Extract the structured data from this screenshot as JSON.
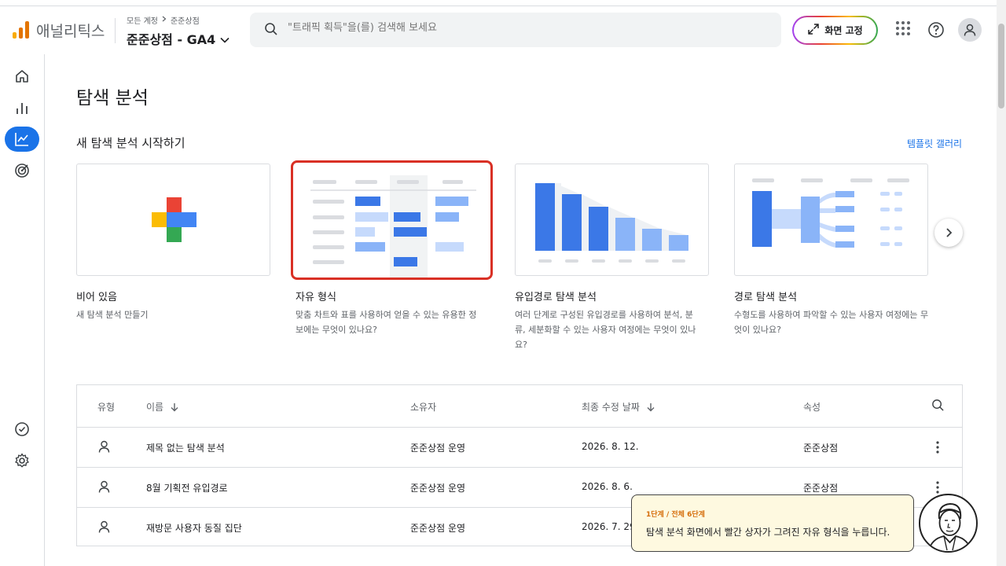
{
  "header": {
    "logo_text": "애널리틱스",
    "breadcrumb": [
      "모든 계정",
      "준준상점"
    ],
    "account_title": "준준상점 - GA4",
    "search_placeholder": "\"트래픽 획득\"을(를) 검색해 보세요",
    "pin_label": "화면 고정",
    "logo_colors": [
      "#f9ab00",
      "#e37400",
      "#e37400"
    ]
  },
  "sidebar": {
    "items": [
      {
        "icon": "home-icon"
      },
      {
        "icon": "bar-chart-icon"
      },
      {
        "icon": "explore-icon",
        "active": true
      },
      {
        "icon": "advertising-icon"
      },
      {
        "icon": "check-circle-icon"
      },
      {
        "icon": "gear-icon"
      }
    ],
    "active_color": "#1a73e8"
  },
  "main": {
    "page_title": "탐색 분석",
    "section_title": "새 탐색 분석 시작하기",
    "template_link": "템플릿 갤러리",
    "cards": [
      {
        "title": "비어 있음",
        "desc": "새 탐색 분석 만들기"
      },
      {
        "title": "자유 형식",
        "desc": "맞춤 차트와 표를 사용하여 얻을 수 있는 유용한 정보에는 무엇이 있나요?"
      },
      {
        "title": "유입경로 탐색 분석",
        "desc": "여러 단계로 구성된 유입경로를 사용하여 분석, 분류, 세분화할 수 있는 사용자 여정에는 무엇이 있나요?"
      },
      {
        "title": "경로 탐색 분석",
        "desc": "수형도를 사용하여 파악할 수 있는 사용자 여정에는 무엇이 있나요?"
      }
    ]
  },
  "table": {
    "headers": {
      "type": "유형",
      "name": "이름",
      "owner": "소유자",
      "modified": "최종 수정 날짜",
      "property": "속성"
    },
    "rows": [
      {
        "name": "제목 없는 탐색 분석",
        "owner": "준준상점 운영",
        "modified": "2026. 8. 12.",
        "property": "준준상점"
      },
      {
        "name": "8월 기획전 유입경로",
        "owner": "준준상점 운영",
        "modified": "2026. 8. 6.",
        "property": "준준상점"
      },
      {
        "name": "재방문 사용자 동질 집단",
        "owner": "준준상점 운영",
        "modified": "2026. 7. 29",
        "property": ""
      }
    ]
  },
  "tooltip": {
    "step": "1단계 / 전체 6단계",
    "text": "탐색 분석 화면에서 빨간 상자가 그려진 자유 형식을 누릅니다."
  }
}
